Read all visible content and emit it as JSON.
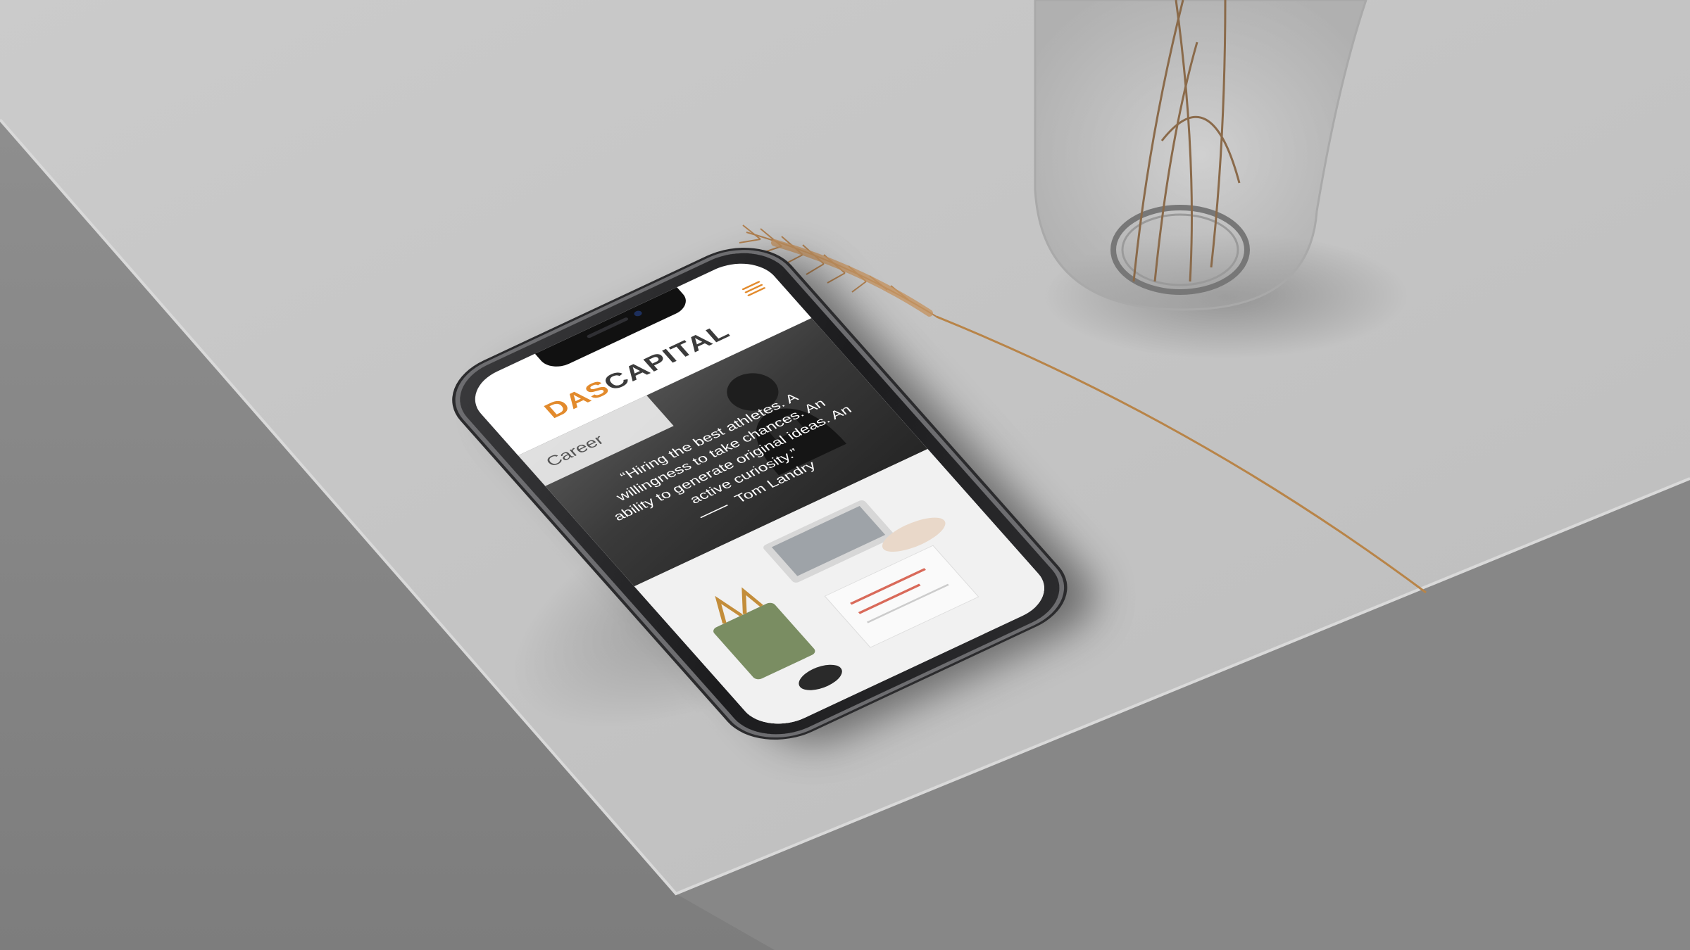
{
  "website": {
    "logo": {
      "part1": "DAS",
      "part2": "CAPITAL"
    },
    "section_label": "Career",
    "quote": "“Hiring the best athletes. A willingness to take chances. An ability to generate original ideas. An active curiosity.”",
    "author": "Tom Landry",
    "icons": {
      "menu": "hamburger-menu-icon"
    }
  },
  "colors": {
    "brand_orange": "#e28a2c",
    "brand_dark": "#3b3b3b",
    "table_surface": "#c8c8c8",
    "table_side": "#8a8a8a"
  }
}
